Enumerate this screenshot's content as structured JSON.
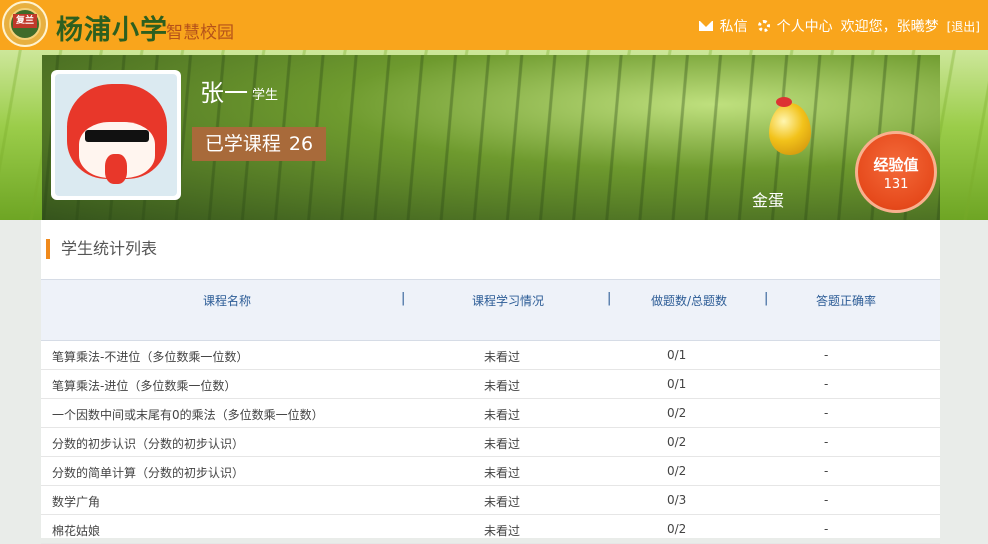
{
  "header": {
    "logo_text": "复兰",
    "school_name": "杨浦小学",
    "school_sub": "智慧校园",
    "messages_label": "私信",
    "profile_label": "个人中心",
    "welcome": "欢迎您，张曦梦",
    "logout": "[退出]"
  },
  "profile": {
    "name": "张一",
    "role": "学生",
    "courses_label": "已学课程",
    "courses_count": "26",
    "badge_label": "金蛋",
    "xp_label": "经验值",
    "xp_value": "131"
  },
  "stats": {
    "title": "学生统计列表",
    "columns": [
      "课程名称",
      "课程学习情况",
      "做题数/总题数",
      "答题正确率"
    ],
    "rows": [
      {
        "name": "笔算乘法-不进位（多位数乘一位数）",
        "status": "未看过",
        "progress": "0/1",
        "accuracy": "-"
      },
      {
        "name": "笔算乘法-进位（多位数乘一位数）",
        "status": "未看过",
        "progress": "0/1",
        "accuracy": "-"
      },
      {
        "name": "一个因数中间或末尾有0的乘法（多位数乘一位数）",
        "status": "未看过",
        "progress": "0/2",
        "accuracy": "-"
      },
      {
        "name": "分数的初步认识（分数的初步认识）",
        "status": "未看过",
        "progress": "0/2",
        "accuracy": "-"
      },
      {
        "name": "分数的简单计算（分数的初步认识）",
        "status": "未看过",
        "progress": "0/2",
        "accuracy": "-"
      },
      {
        "name": "数学广角",
        "status": "未看过",
        "progress": "0/3",
        "accuracy": "-"
      },
      {
        "name": "棉花姑娘",
        "status": "未看过",
        "progress": "0/2",
        "accuracy": "-"
      }
    ]
  }
}
